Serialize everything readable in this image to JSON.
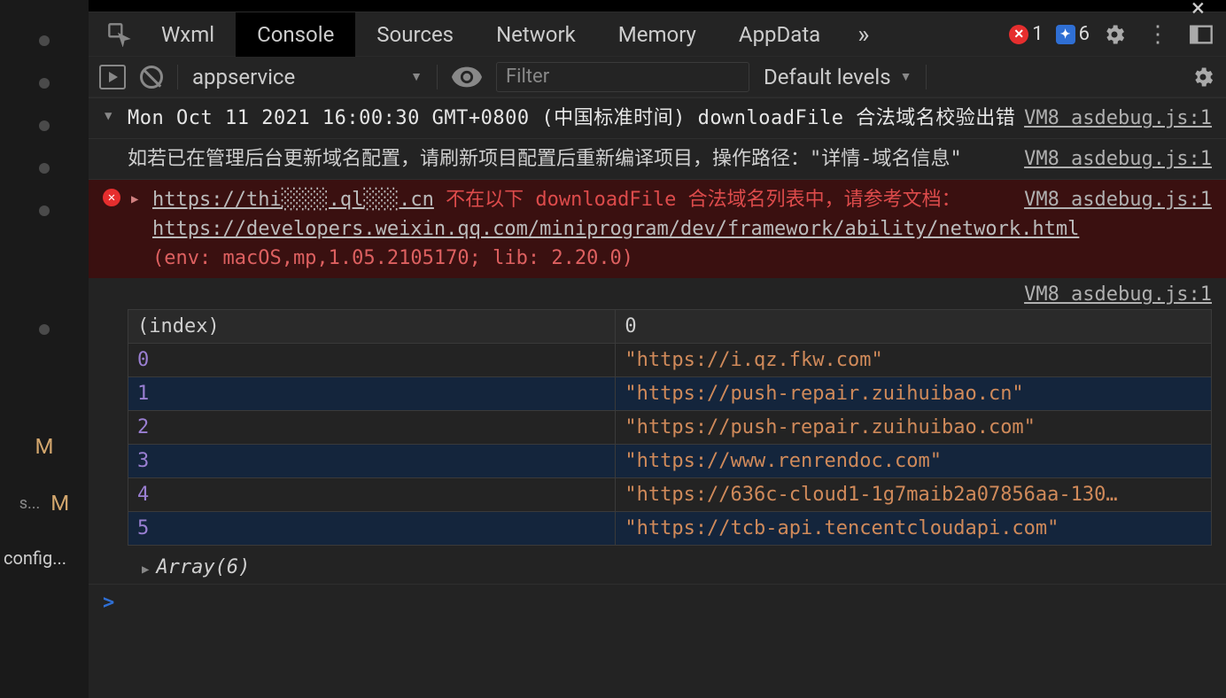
{
  "left": {
    "status": [
      "M",
      "M"
    ],
    "srow": "s...",
    "config": "config..."
  },
  "tabs": {
    "items": [
      "Wxml",
      "Console",
      "Sources",
      "Network",
      "Memory",
      "AppData"
    ],
    "active": 1,
    "overflow": "»"
  },
  "badges": {
    "errors": "1",
    "info": "6"
  },
  "toolbar": {
    "context": "appservice",
    "filter_placeholder": "Filter",
    "levels": "Default levels"
  },
  "log": {
    "msg0": {
      "text": "Mon Oct 11 2021 16:00:30 GMT+0800 (中国标准时间) downloadFile 合法域名校验出错",
      "src": "VM8 asdebug.js:1"
    },
    "msg1": {
      "text": "如若已在管理后台更新域名配置，请刷新项目配置后重新编译项目，操作路径：\"详情-域名信息\"",
      "src": "VM8 asdebug.js:1"
    },
    "err": {
      "url": "https://thi░░░░.ql░░░.cn",
      "mid": " 不在以下 downloadFile 合法域名列表中，请参考文档：",
      "doc": "https://developers.weixin.qq.com/miniprogram/dev/framework/ability/network.html",
      "env": "(env: macOS,mp,1.05.2105170; lib: 2.20.0)",
      "src": "VM8 asdebug.js:1"
    },
    "table": {
      "src": "VM8 asdebug.js:1",
      "cols": [
        "(index)",
        "0"
      ],
      "rows": [
        {
          "i": "0",
          "v": "\"https://i.qz.fkw.com\""
        },
        {
          "i": "1",
          "v": "\"https://push-repair.zuihuibao.cn\""
        },
        {
          "i": "2",
          "v": "\"https://push-repair.zuihuibao.com\""
        },
        {
          "i": "3",
          "v": "\"https://www.renrendoc.com\""
        },
        {
          "i": "4",
          "v": "\"https://636c-cloud1-1g7maib2a07856aa-130…"
        },
        {
          "i": "5",
          "v": "\"https://tcb-api.tencentcloudapi.com\""
        }
      ]
    },
    "array_summary": "Array(6)"
  },
  "prompt": ">"
}
